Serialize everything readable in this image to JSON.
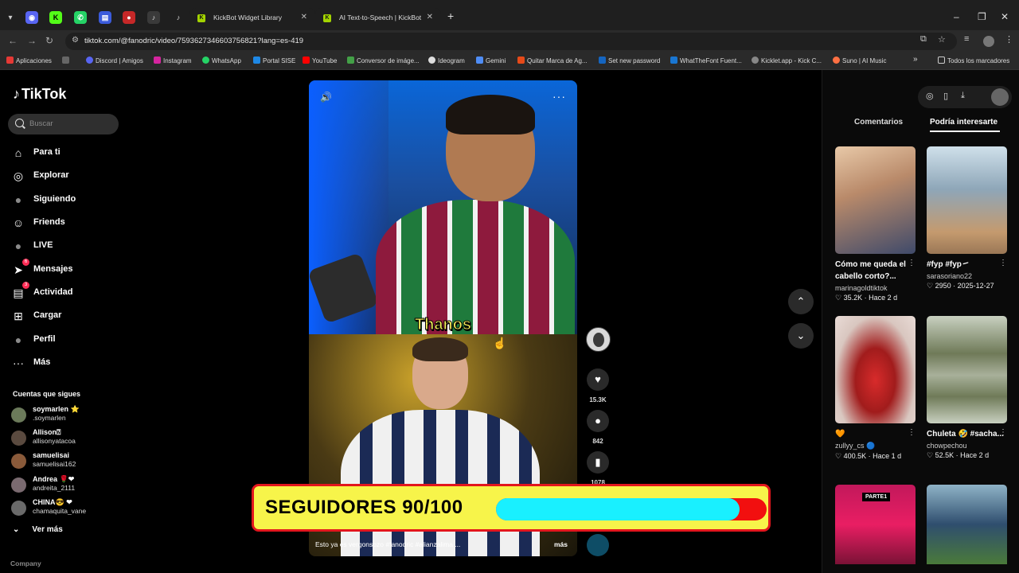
{
  "browser": {
    "tabs": [
      {
        "title": "KickBot Widget Library"
      },
      {
        "title": "AI Text-to-Speech | KickBot"
      }
    ],
    "url": "tiktok.com/@fanodric/video/7593627346603756821?lang=es-419",
    "bookmarks": [
      "Aplicaciones",
      "Discord | Amigos",
      "Instagram",
      "WhatsApp",
      "Portal SISE",
      "YouTube",
      "Conversor de imáge...",
      "Ideogram",
      "Gemini",
      "Quitar Marca de Ag...",
      "Set new password",
      "WhatTheFont Fuent...",
      "Kicklet.app - Kick C...",
      "Suno | AI Music"
    ],
    "bookmarks_folder": "Todos los marcadores",
    "bookmarks_overflow": "»"
  },
  "sidebar": {
    "logo": "TikTok",
    "search_placeholder": "Buscar",
    "nav": [
      {
        "label": "Para ti",
        "icon": "home-icon",
        "glyph": "⌂"
      },
      {
        "label": "Explorar",
        "icon": "compass-icon",
        "glyph": "◎"
      },
      {
        "label": "Siguiendo",
        "icon": "following-avatar-icon",
        "glyph": "●"
      },
      {
        "label": "Friends",
        "icon": "friends-icon",
        "glyph": "☺"
      },
      {
        "label": "LIVE",
        "icon": "live-icon",
        "glyph": "●"
      },
      {
        "label": "Mensajes",
        "icon": "messages-icon",
        "glyph": "➤",
        "badge": "6"
      },
      {
        "label": "Actividad",
        "icon": "activity-icon",
        "glyph": "▤",
        "badge": "3"
      },
      {
        "label": "Cargar",
        "icon": "upload-icon",
        "glyph": "⊞"
      },
      {
        "label": "Perfil",
        "icon": "profile-avatar-icon",
        "glyph": "●"
      },
      {
        "label": "Más",
        "icon": "more-icon",
        "glyph": "···"
      }
    ],
    "following_title": "Cuentas que sigues",
    "accounts": [
      {
        "name": "soymarlen ⭐",
        "handle": ".soymarlen"
      },
      {
        "name": "Allison⍰",
        "handle": "allisonyatacoa"
      },
      {
        "name": "samuelisai",
        "handle": "samuelisai162"
      },
      {
        "name": "Andrea 🌹❤",
        "handle": "andreita_2111"
      },
      {
        "name": "CHINA😎 ❤",
        "handle": "chamaquita_vane"
      }
    ],
    "see_more": "Ver más",
    "company": "Company"
  },
  "video": {
    "caption_word": "Thanos",
    "description": "Esto ya es vergonsozo #fanodric #alianzalima ...",
    "more_label": "más",
    "likes": "15.3K",
    "comments": "842",
    "saves": "1078"
  },
  "overlay": {
    "label": "SEGUIDORES 90/100",
    "current": 90,
    "goal": 100,
    "fill_color": "#19f0ff",
    "track_color": "#f20f0f"
  },
  "panel": {
    "tabs": [
      "Comentarios",
      "Podría interesarte"
    ],
    "active_tab": "Podría interesarte",
    "cards": [
      {
        "title": "Cómo me queda el cabello corto?...",
        "user": "marinagoldtiktok",
        "likes": "35.2K",
        "date": "Hace 2 d"
      },
      {
        "title": "#fyp #fyp㇀",
        "user": "sarasoriano22",
        "likes": "2950",
        "date": "2025-12-27"
      },
      {
        "title": "🧡",
        "user": "zullyy_cs 🔵",
        "likes": "400.5K",
        "date": "Hace 1 d"
      },
      {
        "title": "Chuleta 🤣 #sacha...",
        "user": "chowpechou",
        "likes": "52.5K",
        "date": "Hace 2 d"
      },
      {
        "title": "PARTE1",
        "user": "",
        "likes": "",
        "date": ""
      },
      {
        "title": "",
        "user": "",
        "likes": "",
        "date": ""
      }
    ]
  }
}
